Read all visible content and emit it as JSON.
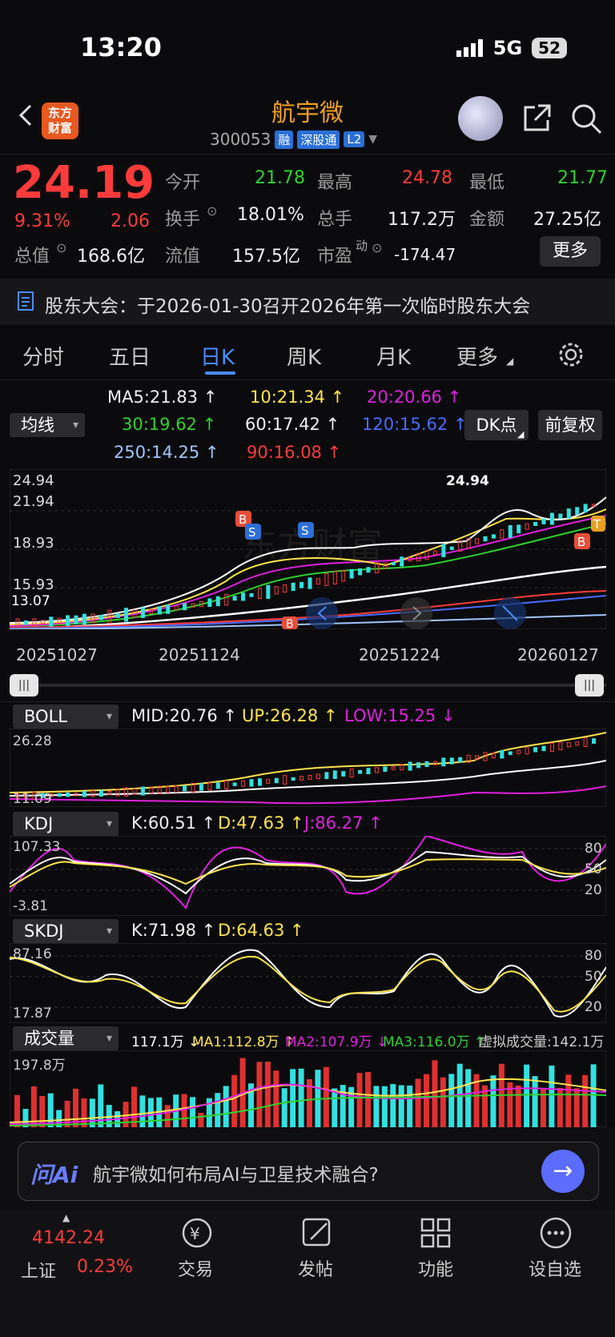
{
  "status": {
    "time": "13:20",
    "network": "5G",
    "battery": "52"
  },
  "header": {
    "logo_line1": "东方",
    "logo_line2": "财富",
    "name": "航宇微",
    "code": "300053",
    "tags": [
      "融",
      "深股通",
      "L2"
    ]
  },
  "quote": {
    "price": "24.19",
    "pct": "9.31%",
    "change": "2.06",
    "open_label": "今开",
    "open": "21.78",
    "high_label": "最高",
    "high": "24.78",
    "low_label": "最低",
    "low": "21.77",
    "turnover_label": "换手",
    "turnover": "18.01%",
    "vol_label": "总手",
    "vol": "117.2万",
    "amount_label": "金额",
    "amount": "27.25亿",
    "mcap_label": "总值",
    "mcap": "168.6亿",
    "float_label": "流值",
    "float": "157.5亿",
    "pe_label": "市盈",
    "pe_sup": "动",
    "pe": "-174.47",
    "more": "更多"
  },
  "notice": "股东大会：于2026-01-30召开2026年第一次临时股东大会",
  "tabs": [
    "分时",
    "五日",
    "日K",
    "周K",
    "月K",
    "更多"
  ],
  "ma": {
    "selector": "均线",
    "dk": "DK点",
    "adj": "前复权",
    "ma5": "MA5:21.83 ↑",
    "ma10": "10:21.34 ↑",
    "ma20": "20:20.66 ↑",
    "ma30": "30:19.62 ↑",
    "ma60": "60:17.42 ↑",
    "ma120": "120:15.62 ↑",
    "ma250": "250:14.25 ↑",
    "ma90": "90:16.08 ↑"
  },
  "kline": {
    "yticks": [
      "24.94",
      "21.94",
      "18.93",
      "15.93"
    ],
    "low_mark": "13.07",
    "high_mark": "24.94",
    "dates": [
      "20251027",
      "20251124",
      "20251224",
      "20260127"
    ]
  },
  "boll": {
    "label": "BOLL",
    "mid": "MID:20.76 ↑",
    "up": "UP:26.28 ↑",
    "low": "LOW:15.25 ↓",
    "y1": "26.28",
    "y2": "11.09"
  },
  "kdj": {
    "label": "KDJ",
    "k": "K:60.51 ↑",
    "d": "D:47.63 ↑",
    "j": "J:86.27 ↑",
    "y1": "107.33",
    "y2": "-3.81",
    "r1": "80",
    "r2": "50",
    "r3": "20"
  },
  "skdj": {
    "label": "SKDJ",
    "k": "K:71.98 ↑",
    "d": "D:64.63 ↑",
    "y1": "87.16",
    "y2": "17.87",
    "r1": "80",
    "r2": "50",
    "r3": "20"
  },
  "volume": {
    "label": "成交量",
    "v": "117.1万 ↓",
    "ma1": "MA1:112.8万 ↑",
    "ma2": "MA2:107.9万 ↓",
    "ma3": "MA3:116.0万 ↑",
    "virtual": "虚拟成交量:142.1万",
    "y1": "197.8万"
  },
  "ai": {
    "logo": "问Ai",
    "question": "航宇微如何布局AI与卫星技术融合?"
  },
  "nav": {
    "index_value": "4142.24",
    "index_name": "上证",
    "index_pct": "0.23%",
    "items": [
      "交易",
      "发帖",
      "功能",
      "设自选"
    ]
  }
}
